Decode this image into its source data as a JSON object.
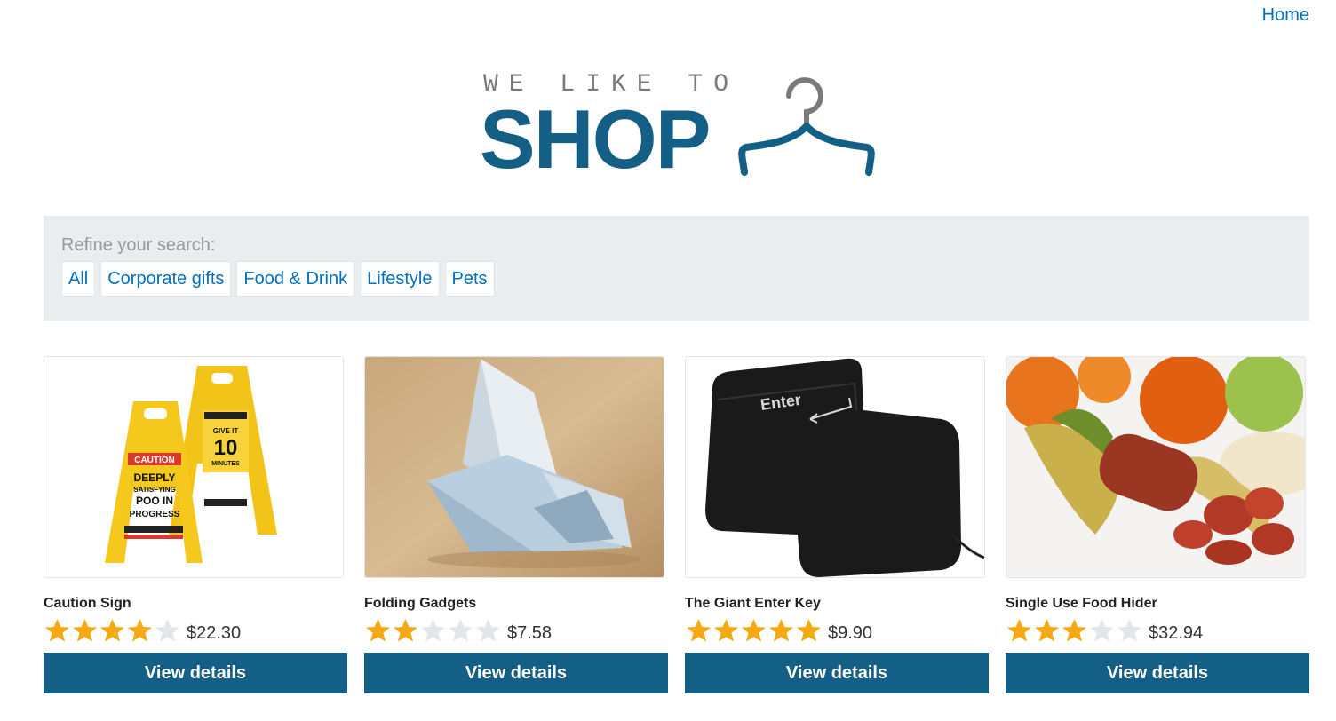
{
  "nav": {
    "home_label": "Home"
  },
  "logo": {
    "small_text": "WE LIKE TO",
    "big_text": "SHOP"
  },
  "filters": {
    "title": "Refine your search:",
    "items": [
      "All",
      "Corporate gifts",
      "Food & Drink",
      "Lifestyle",
      "Pets"
    ]
  },
  "products": [
    {
      "name": "Caution Sign",
      "rating": 4,
      "max_rating": 5,
      "price": "$22.30",
      "button_label": "View details",
      "image": "yellow-caution-signs"
    },
    {
      "name": "Folding Gadgets",
      "rating": 2,
      "max_rating": 5,
      "price": "$7.58",
      "button_label": "View details",
      "image": "origami-banknote-bird"
    },
    {
      "name": "The Giant Enter Key",
      "rating": 5,
      "max_rating": 5,
      "price": "$9.90",
      "button_label": "View details",
      "image": "giant-enter-key-cushion"
    },
    {
      "name": "Single Use Food Hider",
      "rating": 3,
      "max_rating": 5,
      "price": "$32.94",
      "button_label": "View details",
      "image": "sausage-in-banana-peel"
    }
  ],
  "colors": {
    "brand": "#145f86",
    "link": "#0071bc",
    "star_on": "#f6a912",
    "star_off": "#e3e6e8",
    "panel": "#e9edf0"
  },
  "image_text": {
    "caution_label": "CAUTION",
    "caution_line1": "DEEPLY",
    "caution_line2": "SATISFYING",
    "caution_line3": "POO IN",
    "caution_line4": "PROGRESS",
    "sign2_line1": "GIVE IT",
    "sign2_line2": "10",
    "sign2_line3": "MINUTES",
    "enter_key_label": "Enter"
  }
}
